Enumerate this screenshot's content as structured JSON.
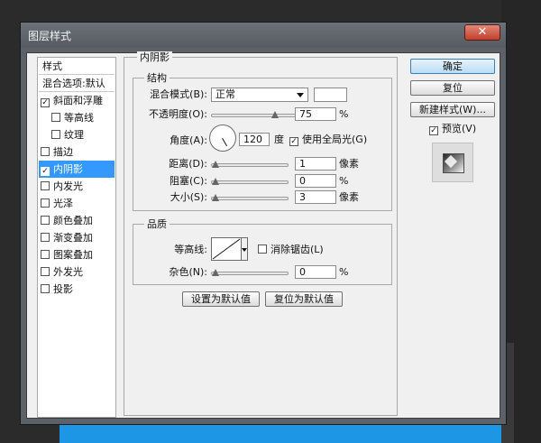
{
  "window": {
    "title": "图层样式",
    "close_symbol": "✕"
  },
  "style_list": {
    "header": "样式",
    "blend_default": "混合选项:默认",
    "items": [
      {
        "label": "斜面和浮雕",
        "checked": true,
        "check_mark": "✓",
        "indent": false,
        "selected": false
      },
      {
        "label": "等高线",
        "checked": false,
        "check_mark": "",
        "indent": true,
        "selected": false
      },
      {
        "label": "纹理",
        "checked": false,
        "check_mark": "",
        "indent": true,
        "selected": false
      },
      {
        "label": "描边",
        "checked": false,
        "check_mark": "",
        "indent": false,
        "selected": false
      },
      {
        "label": "内阴影",
        "checked": true,
        "check_mark": "✓",
        "indent": false,
        "selected": true
      },
      {
        "label": "内发光",
        "checked": false,
        "check_mark": "",
        "indent": false,
        "selected": false
      },
      {
        "label": "光泽",
        "checked": false,
        "check_mark": "",
        "indent": false,
        "selected": false
      },
      {
        "label": "颜色叠加",
        "checked": false,
        "check_mark": "",
        "indent": false,
        "selected": false
      },
      {
        "label": "渐变叠加",
        "checked": false,
        "check_mark": "",
        "indent": false,
        "selected": false
      },
      {
        "label": "图案叠加",
        "checked": false,
        "check_mark": "",
        "indent": false,
        "selected": false
      },
      {
        "label": "外发光",
        "checked": false,
        "check_mark": "",
        "indent": false,
        "selected": false
      },
      {
        "label": "投影",
        "checked": false,
        "check_mark": "",
        "indent": false,
        "selected": false
      }
    ]
  },
  "panel": {
    "title": "内阴影",
    "structure": {
      "legend": "结构",
      "blend_mode_label": "混合模式(B):",
      "blend_mode_value": "正常",
      "shadow_color": "#ffffff",
      "opacity_label": "不透明度(O):",
      "opacity_value": "75",
      "opacity_unit": "%",
      "opacity_fraction": 0.75,
      "angle_label": "角度(A):",
      "angle_value": "120",
      "angle_unit": "度",
      "global_light_label": "使用全局光(G)",
      "global_light_checked": true,
      "global_light_mark": "✓",
      "distance_label": "距离(D):",
      "distance_value": "1",
      "distance_unit": "像素",
      "distance_fraction": 0.0,
      "choke_label": "阻塞(C):",
      "choke_value": "0",
      "choke_unit": "%",
      "choke_fraction": 0.0,
      "size_label": "大小(S):",
      "size_value": "3",
      "size_unit": "像素",
      "size_fraction": 0.0
    },
    "quality": {
      "legend": "品质",
      "contour_label": "等高线:",
      "anti_alias_label": "消除锯齿(L)",
      "anti_alias_checked": false,
      "noise_label": "杂色(N):",
      "noise_value": "0",
      "noise_unit": "%",
      "noise_fraction": 0.0
    },
    "make_default_label": "设置为默认值",
    "reset_default_label": "复位为默认值"
  },
  "actions": {
    "ok_label": "确定",
    "reset_label": "复位",
    "new_style_label": "新建样式(W)...",
    "preview_label": "预览(V)",
    "preview_checked": true,
    "preview_mark": "✓"
  },
  "colors": {
    "selection": "#3399ff",
    "background_accent": "#1e96e6"
  }
}
